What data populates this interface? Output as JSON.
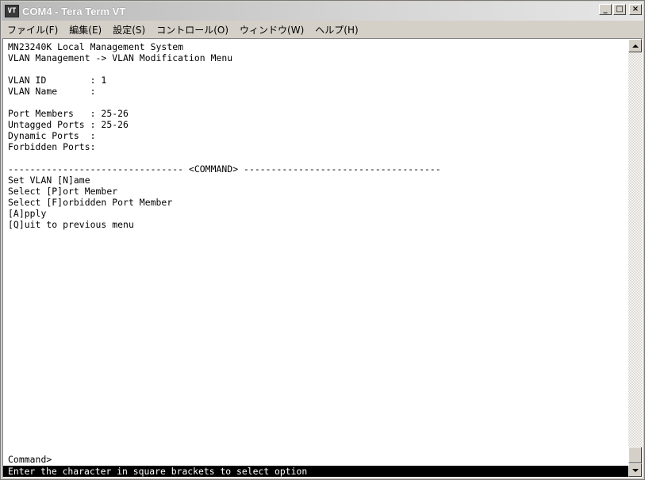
{
  "window": {
    "title": "COM4 - Tera Term VT",
    "icon_label": "VT",
    "controls": {
      "minimize": "_",
      "maximize": "□",
      "close": "×"
    }
  },
  "menubar": {
    "items": [
      "ファイル(F)",
      "編集(E)",
      "設定(S)",
      "コントロール(O)",
      "ウィンドウ(W)",
      "ヘルプ(H)"
    ]
  },
  "terminal": {
    "lines": [
      "MN23240K Local Management System",
      "VLAN Management -> VLAN Modification Menu",
      "",
      "VLAN ID        : 1",
      "VLAN Name      :",
      "",
      "Port Members   : 25-26",
      "Untagged Ports : 25-26",
      "Dynamic Ports  :",
      "Forbidden Ports:",
      "",
      "-------------------------------- <COMMAND> ------------------------------------",
      "Set VLAN [N]ame",
      "Select [P]ort Member",
      "Select [F]orbidden Port Member",
      "[A]pply",
      "[Q]uit to previous menu",
      "",
      "",
      "",
      "",
      "",
      "",
      "Command>"
    ],
    "status": "Enter the character in square brackets to select option"
  },
  "colors": {
    "terminal_bg": "#ffffff",
    "terminal_fg": "#000000",
    "status_bg": "#000000",
    "status_fg": "#ffffff",
    "chrome": "#d4d0c8"
  }
}
